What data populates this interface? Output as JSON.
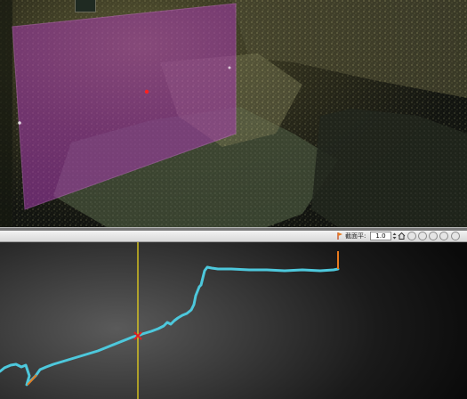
{
  "toolbar": {
    "resolution_label": "截面平:",
    "resolution_value": "1.0",
    "icons": [
      "profile-marker-icon",
      "home-icon",
      "zoom-out-icon",
      "zoom-in-icon",
      "play-icon",
      "settings-icon",
      "close-icon"
    ]
  },
  "colors": {
    "section_plane": "#a83cb0",
    "profile_line": "#4dc8dc",
    "cursor_line": "#e8d21c",
    "cursor_marker": "#e02020",
    "endpoint_marker": "#e87a1e"
  }
}
